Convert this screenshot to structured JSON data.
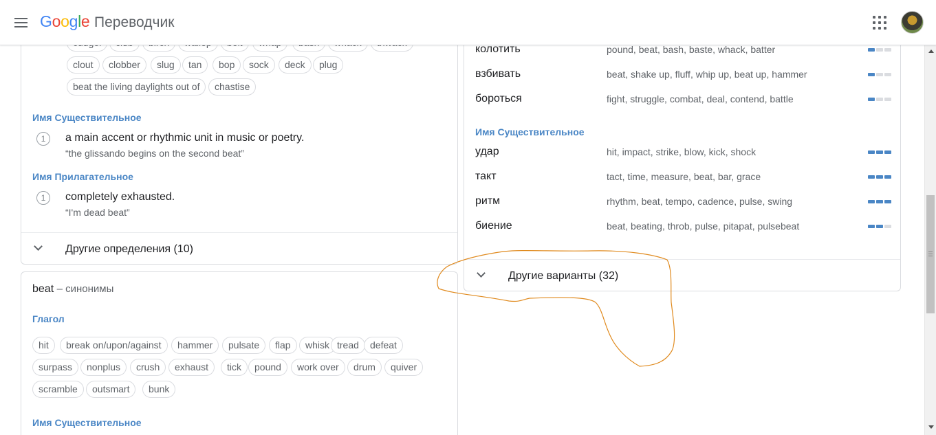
{
  "header": {
    "logo": [
      "G",
      "o",
      "o",
      "g",
      "l",
      "e"
    ],
    "product_name": "Переводчик"
  },
  "icons": {
    "menu": "hamburger-menu-icon",
    "apps": "apps-grid-icon",
    "avatar": "user-avatar"
  },
  "definitions": {
    "top_chips_row1": [
      "cudgel",
      "club",
      "birch",
      "wallop",
      "belt",
      "whap",
      "bash",
      "whack",
      "thwack"
    ],
    "top_chips_row2": [
      "clout",
      "clobber",
      "slug",
      "tan",
      "bop",
      "sock",
      "deck",
      "plug"
    ],
    "top_chips_row3": [
      "beat the living daylights out of",
      "chastise"
    ],
    "noun_label": "Имя Существительное",
    "noun_num": "1",
    "noun_def": "a main accent or rhythmic unit in music or poetry.",
    "noun_example": "“the glissando begins on the second beat”",
    "adj_label": "Имя Прилагательное",
    "adj_num": "1",
    "adj_def": "completely exhausted.",
    "adj_example": "“I'm dead beat”",
    "more_label": "Другие определения (10)"
  },
  "synonyms": {
    "word": "beat",
    "suffix": "– синонимы",
    "verb_label": "Глагол",
    "verb_row1": [
      "hit",
      "break on/upon/against",
      "hammer",
      "pulsate",
      "flap",
      "whisk",
      "tread",
      "defeat"
    ],
    "verb_row2": [
      "surpass",
      "nonplus",
      "crush",
      "exhaust",
      "tick",
      "pound",
      "work over",
      "drum",
      "quiver"
    ],
    "verb_row3": [
      "scramble",
      "outsmart",
      "bunk"
    ],
    "noun_label": "Имя Существительное"
  },
  "translations": {
    "verb_rows": [
      {
        "word": "колотить",
        "syns": "pound, beat, bash, baste, whack, batter",
        "freq": 1
      },
      {
        "word": "взбивать",
        "syns": "beat, shake up, fluff, whip up, beat up, hammer",
        "freq": 1
      },
      {
        "word": "бороться",
        "syns": "fight, struggle, combat, deal, contend, battle",
        "freq": 1
      }
    ],
    "noun_label": "Имя Существительное",
    "noun_rows": [
      {
        "word": "удар",
        "syns": "hit, impact, strike, blow, kick, shock",
        "freq": 3
      },
      {
        "word": "такт",
        "syns": "tact, time, measure, beat, bar, grace",
        "freq": 3
      },
      {
        "word": "ритм",
        "syns": "rhythm, beat, tempo, cadence, pulse, swing",
        "freq": 3
      },
      {
        "word": "биение",
        "syns": "beat, beating, throb, pulse, pitapat, pulsebeat",
        "freq": 2
      }
    ],
    "more_label": "Другие варианты (32)"
  },
  "colors": {
    "accent": "#4a86c5",
    "annotation": "#e08a1e"
  }
}
